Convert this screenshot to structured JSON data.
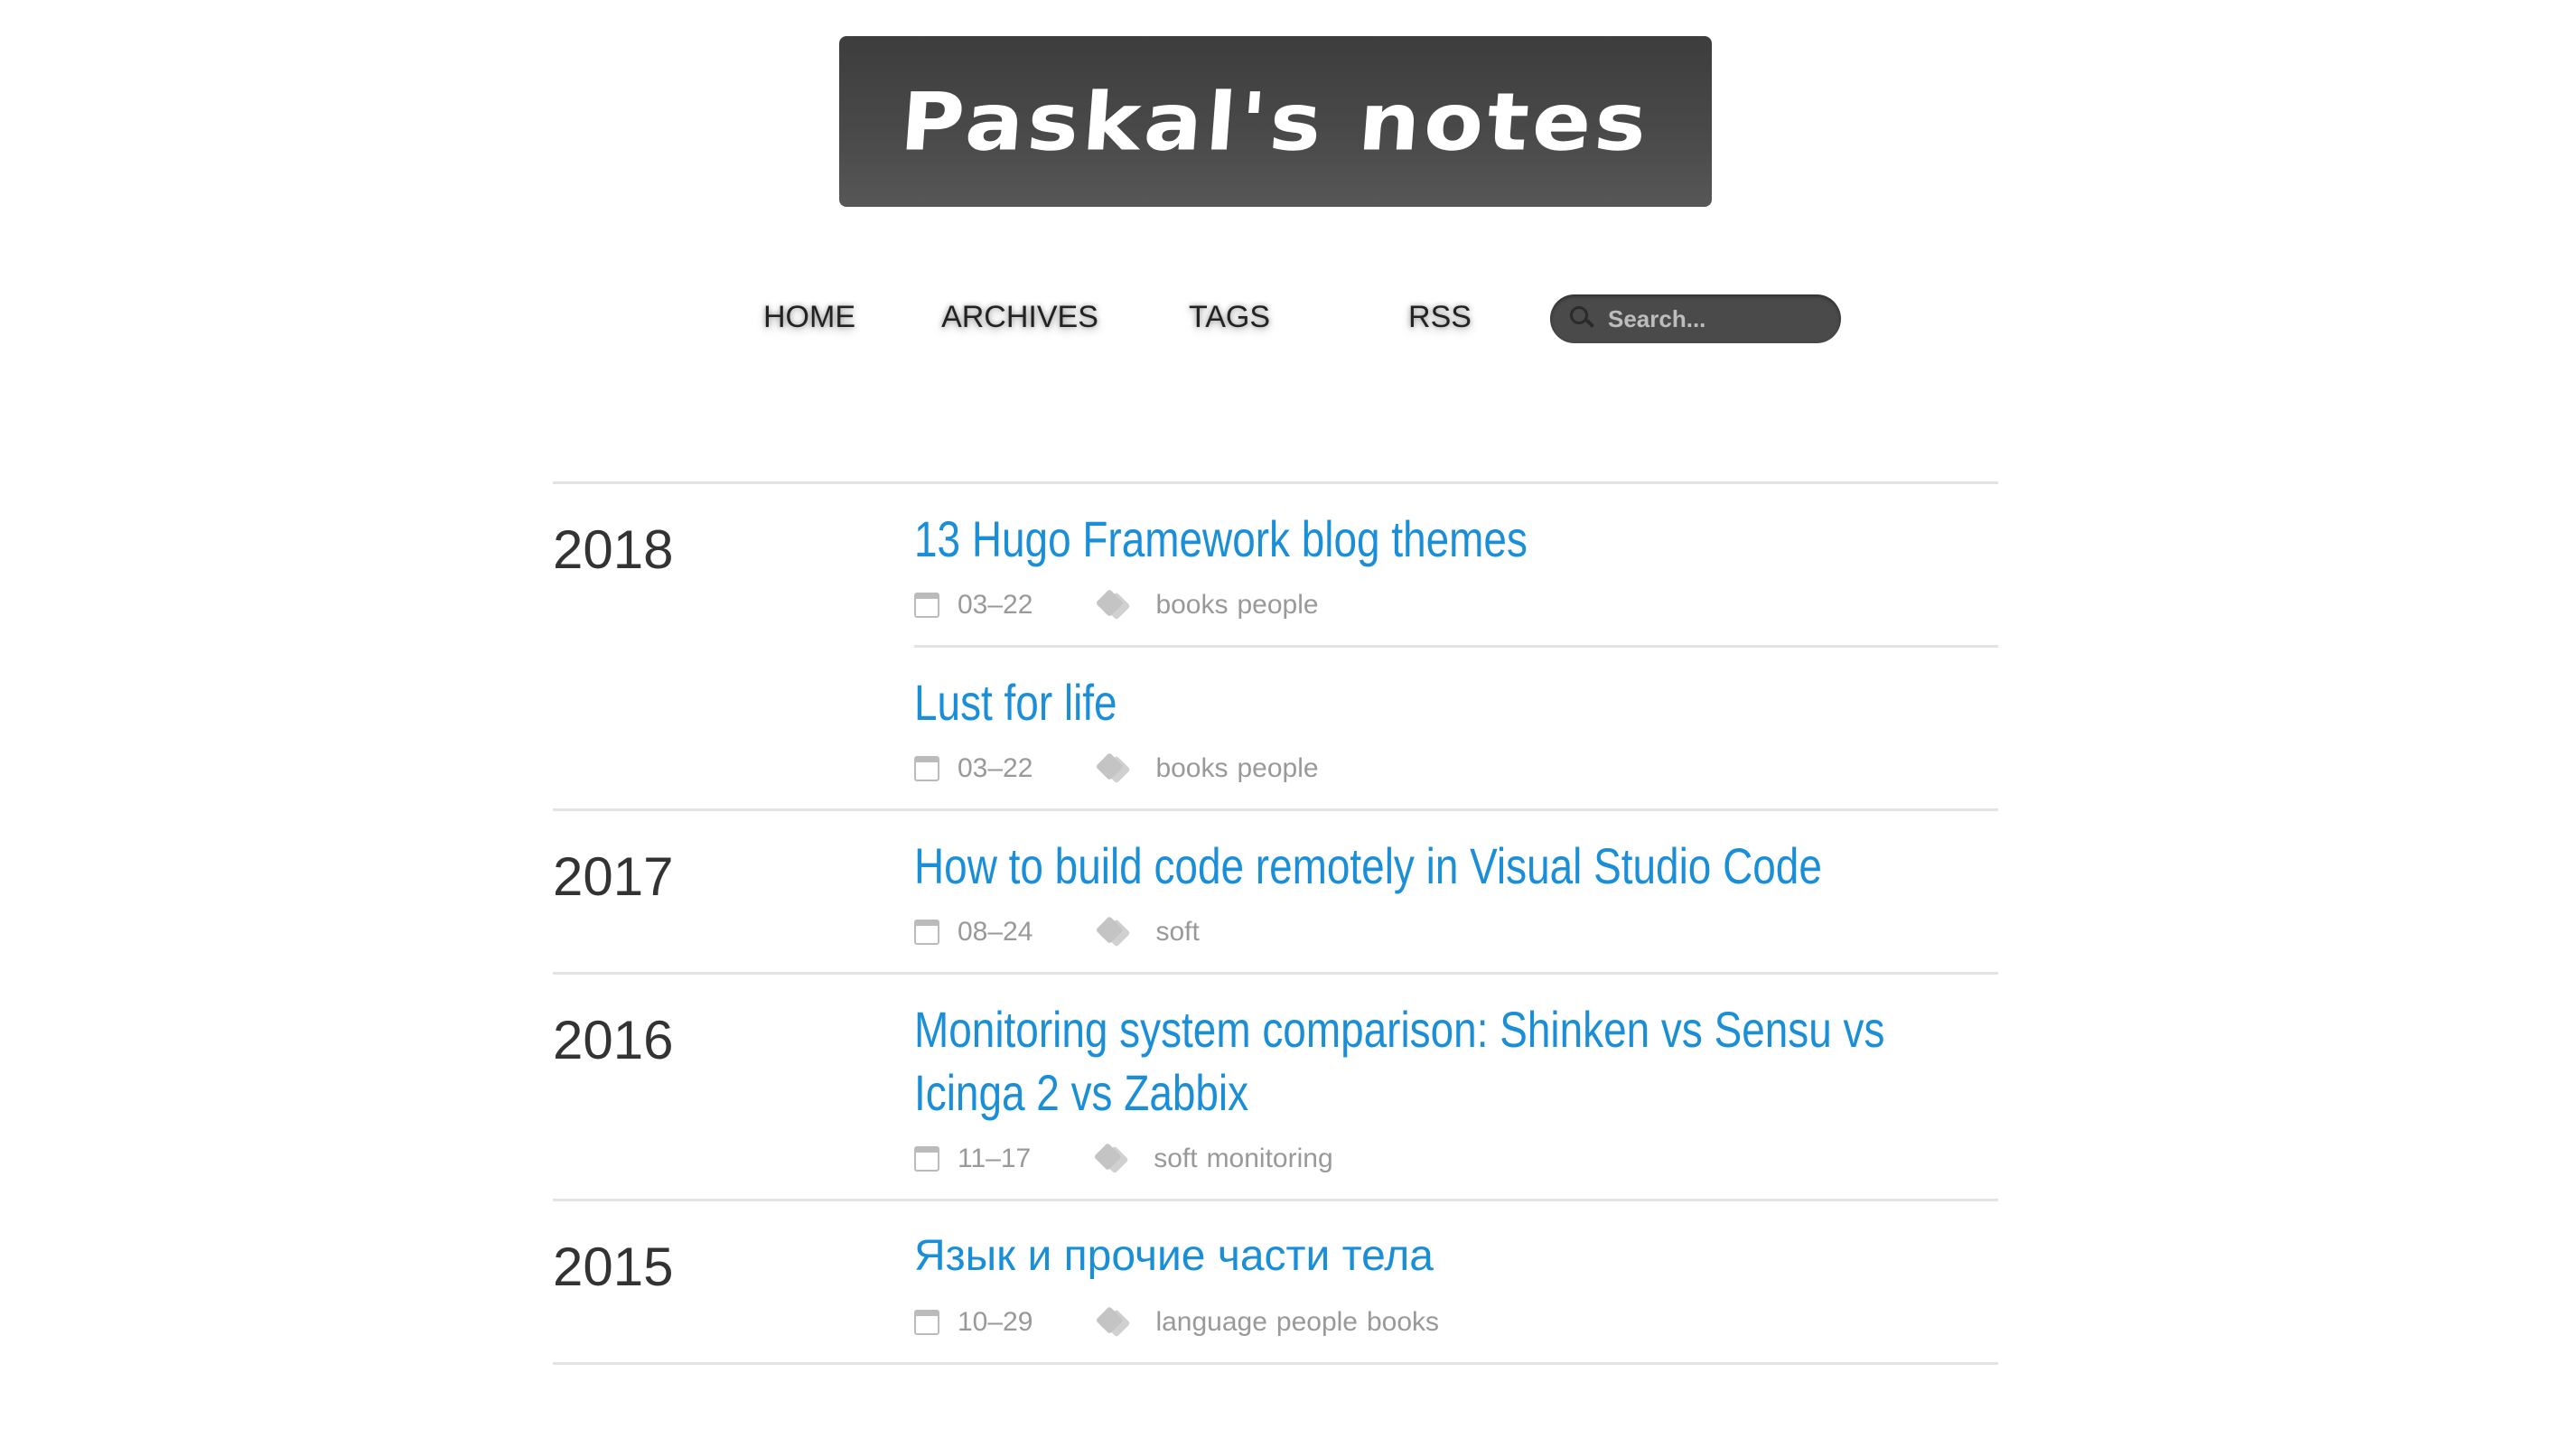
{
  "site": {
    "logo_text": "Paskal's notes",
    "logo_bg": "#4a4a4a"
  },
  "nav": {
    "items": [
      {
        "label": "HOME"
      },
      {
        "label": "ARCHIVES"
      },
      {
        "label": "TAGS"
      },
      {
        "label": "RSS"
      }
    ],
    "search_placeholder": "Search...",
    "search_icon": "search-icon"
  },
  "colors": {
    "link": "#1a8fd8",
    "meta": "#999999",
    "year": "#333333"
  },
  "archive": [
    {
      "year": "2018",
      "posts": [
        {
          "title": "13 Hugo Framework blog themes",
          "date": "03–22",
          "tags": [
            "books",
            "people"
          ]
        },
        {
          "title": "Lust for life",
          "date": "03–22",
          "tags": [
            "books",
            "people"
          ]
        }
      ]
    },
    {
      "year": "2017",
      "posts": [
        {
          "title": "How to build code remotely in Visual Studio Code",
          "date": "08–24",
          "tags": [
            "soft"
          ]
        }
      ]
    },
    {
      "year": "2016",
      "posts": [
        {
          "title": "Monitoring system comparison: Shinken vs Sensu vs Icinga 2 vs Zabbix",
          "date": "11–17",
          "tags": [
            "soft",
            "monitoring"
          ]
        }
      ]
    },
    {
      "year": "2015",
      "posts": [
        {
          "title": "Язык и прочие части тела",
          "date": "10–29",
          "tags": [
            "language",
            "people",
            "books"
          ]
        }
      ]
    }
  ]
}
